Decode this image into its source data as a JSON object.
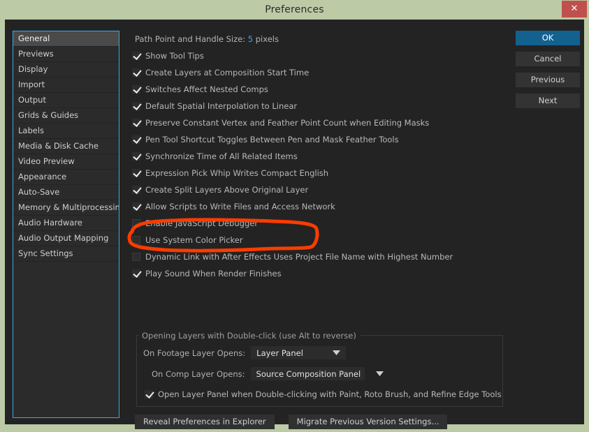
{
  "window": {
    "title": "Preferences",
    "close_label": "✕",
    "titlebar_color": "#bccaa6",
    "close_color": "#c0504d",
    "body_color": "#232323",
    "accent_color": "#13618f",
    "focus_border_color": "#3da9e8",
    "annotation_color": "#f93c00"
  },
  "sidebar": {
    "selected": "General",
    "items": [
      {
        "label": "General"
      },
      {
        "label": "Previews"
      },
      {
        "label": "Display"
      },
      {
        "label": "Import"
      },
      {
        "label": "Output"
      },
      {
        "label": "Grids & Guides"
      },
      {
        "label": "Labels"
      },
      {
        "label": "Media & Disk Cache"
      },
      {
        "label": "Video Preview"
      },
      {
        "label": "Appearance"
      },
      {
        "label": "Auto-Save"
      },
      {
        "label": "Memory & Multiprocessing"
      },
      {
        "label": "Audio Hardware"
      },
      {
        "label": "Audio Output Mapping"
      },
      {
        "label": "Sync Settings"
      }
    ]
  },
  "dialog_buttons": [
    {
      "label": "OK",
      "primary": true
    },
    {
      "label": "Cancel",
      "primary": false
    },
    {
      "label": "Previous",
      "primary": false
    },
    {
      "label": "Next",
      "primary": false
    }
  ],
  "main": {
    "path_point": {
      "label": "Path Point and Handle Size:",
      "value": "5",
      "unit": "pixels"
    },
    "checkboxes": [
      {
        "label": "Show Tool Tips",
        "checked": true
      },
      {
        "label": "Create Layers at Composition Start Time",
        "checked": true
      },
      {
        "label": "Switches Affect Nested Comps",
        "checked": true
      },
      {
        "label": "Default Spatial Interpolation to Linear",
        "checked": true
      },
      {
        "label": "Preserve Constant Vertex and Feather Point Count when Editing Masks",
        "checked": true
      },
      {
        "label": "Pen Tool Shortcut Toggles Between Pen and Mask Feather Tools",
        "checked": true
      },
      {
        "label": "Synchronize Time of All Related Items",
        "checked": true
      },
      {
        "label": "Expression Pick Whip Writes Compact English",
        "checked": true
      },
      {
        "label": "Create Split Layers Above Original Layer",
        "checked": true
      },
      {
        "label": "Allow Scripts to Write Files and Access Network",
        "checked": true
      },
      {
        "label": "Enable JavaScript Debugger",
        "checked": false
      },
      {
        "label": "Use System Color Picker",
        "checked": false
      },
      {
        "label": "Dynamic Link with After Effects Uses Project File Name with Highest Number",
        "checked": false
      },
      {
        "label": "Play Sound When Render Finishes",
        "checked": true
      }
    ]
  },
  "group": {
    "legend": "Opening Layers with Double-click (use Alt to reverse)",
    "footage_label": "On Footage Layer Opens:",
    "footage_value": "Layer Panel",
    "comp_label": "On Comp Layer Opens:",
    "comp_value": "Source Composition Panel",
    "open_layer_label": "Open Layer Panel when Double-clicking with Paint, Roto Brush, and Refine Edge Tools",
    "open_layer_checked": true
  },
  "bottom_buttons": [
    {
      "label": "Reveal Preferences in Explorer"
    },
    {
      "label": "Migrate Previous Version Settings..."
    }
  ],
  "annotation": {
    "target": "Allow Scripts to Write Files and Access Network",
    "shape": "hand-drawn-oval"
  }
}
